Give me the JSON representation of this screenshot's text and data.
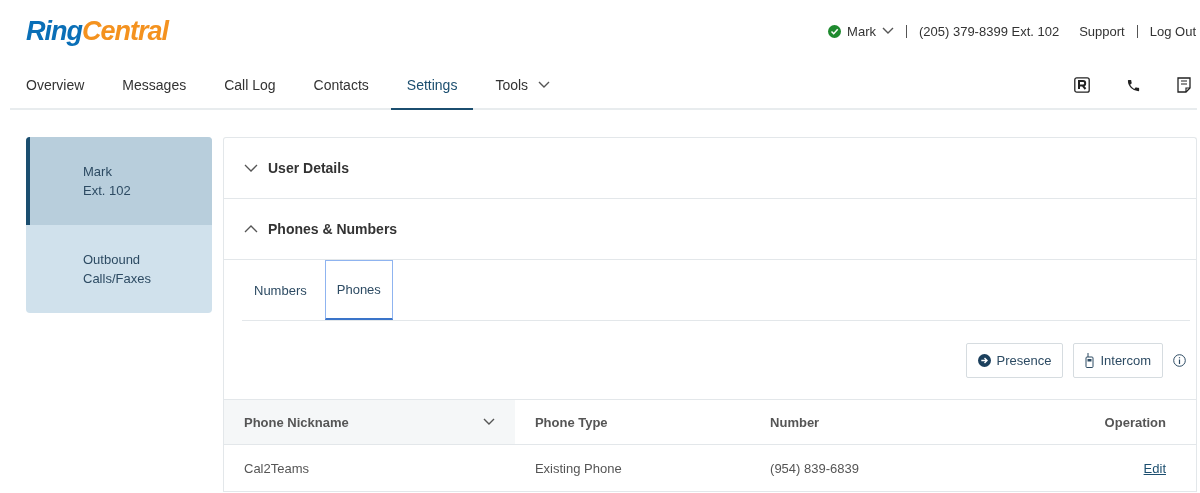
{
  "logo": {
    "part_1": "Ring",
    "part_2": "Central"
  },
  "top_bar": {
    "user": "Mark",
    "available": true,
    "phone": "(205) 379-8399 Ext. 102",
    "links": [
      "Support",
      "Log Out"
    ]
  },
  "nav": [
    {
      "label": "Overview",
      "selected": false,
      "dropdown": false
    },
    {
      "label": "Messages",
      "selected": false,
      "dropdown": false
    },
    {
      "label": "Call Log",
      "selected": false,
      "dropdown": false
    },
    {
      "label": "Contacts",
      "selected": false,
      "dropdown": false
    },
    {
      "label": "Settings",
      "selected": true,
      "dropdown": false
    },
    {
      "label": "Tools",
      "selected": false,
      "dropdown": true
    }
  ],
  "sidebar": {
    "items": [
      {
        "lines": [
          "Mark",
          "Ext. 102"
        ],
        "selected": true
      },
      {
        "lines": [
          "Outbound",
          "Calls/Faxes"
        ],
        "selected": false
      }
    ]
  },
  "sections": [
    {
      "title": "User Details",
      "expanded": false
    },
    {
      "title": "Phones & Numbers",
      "expanded": true
    }
  ],
  "tabs": [
    {
      "label": "Numbers",
      "selected": false
    },
    {
      "label": "Phones",
      "selected": true
    }
  ],
  "buttons": [
    {
      "label": "Presence",
      "kind": "presence"
    },
    {
      "label": "Intercom",
      "kind": "intercom"
    }
  ],
  "table": {
    "columns": [
      {
        "label": "Phone Nickname",
        "sorted": true
      },
      {
        "label": "Phone Type",
        "sorted": false
      },
      {
        "label": "Number",
        "sorted": false
      },
      {
        "label": "Operation",
        "sorted": false
      }
    ],
    "rows": [
      {
        "nickname": "Cal2Teams",
        "type": "Existing Phone",
        "number": "(954) 839-6839",
        "action": "Edit"
      }
    ]
  }
}
